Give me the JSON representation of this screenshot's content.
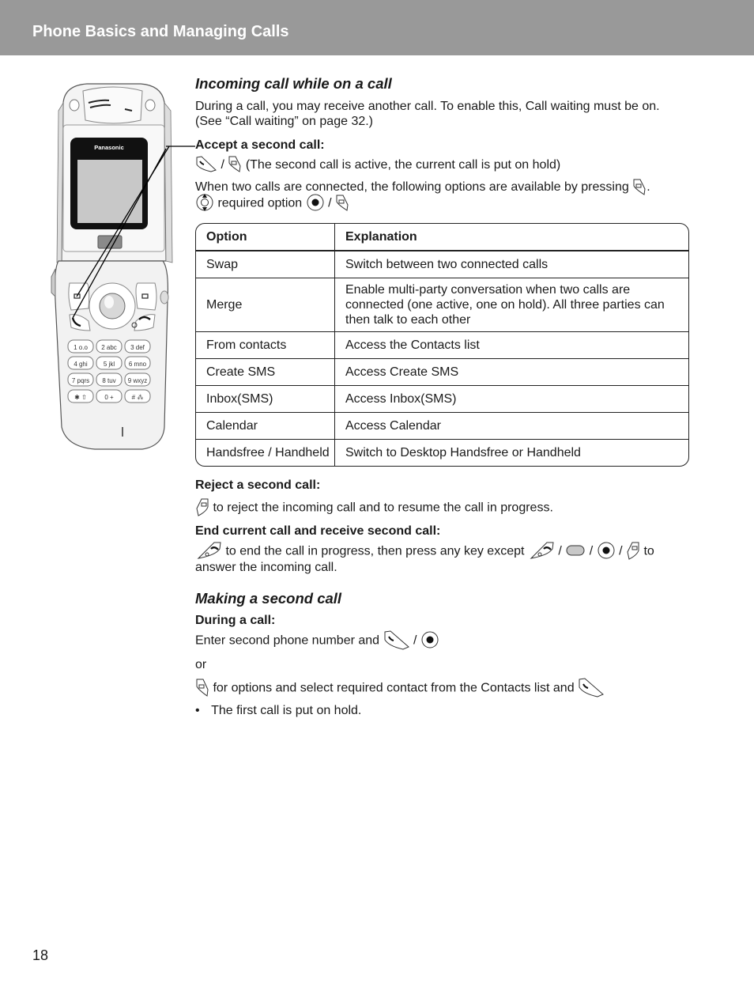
{
  "header": {
    "title": "Phone Basics and Managing Calls"
  },
  "phone_illustration": {
    "brand": "Panasonic",
    "keys": [
      "1 ο.ο",
      "2 abc",
      "3 def",
      "4 ghi",
      "5 jkl",
      "6 mno",
      "7 pqrs",
      "8 tuv",
      "9 wxyz",
      "✱ ⇧",
      "0 +",
      "# ⁂"
    ]
  },
  "section1": {
    "heading": "Incoming call while on a call",
    "intro": "During a call, you may receive another call. To enable this, Call waiting must be on. (See “Call waiting” on page 32.)",
    "accept": {
      "title": "Accept a second call:",
      "separator": "/",
      "text": "(The second call is active, the current call is put on hold)"
    },
    "options_intro": {
      "text": "When two calls are connected, the following options are available by pressing",
      "period": ".",
      "select_text": "required option",
      "separator": "/"
    },
    "table": {
      "headers": [
        "Option",
        "Explanation"
      ],
      "rows": [
        {
          "option": "Swap",
          "explanation": "Switch between two connected calls"
        },
        {
          "option": "Merge",
          "explanation": "Enable multi-party conversation when two calls are connected (one active, one on hold). All three parties can then talk to each other"
        },
        {
          "option": "From contacts",
          "explanation": "Access the Contacts list"
        },
        {
          "option": "Create SMS",
          "explanation": "Access Create SMS"
        },
        {
          "option": "Inbox(SMS)",
          "explanation": "Access Inbox(SMS)"
        },
        {
          "option": "Calendar",
          "explanation": "Access Calendar"
        },
        {
          "option": "Handsfree / Handheld",
          "explanation": "Switch to Desktop Handsfree or Handheld"
        }
      ]
    },
    "reject": {
      "title": "Reject a second call:",
      "text": "to reject the incoming call and to resume the call in progress."
    },
    "end_receive": {
      "title": "End current call and receive second call:",
      "text1": "to end the call in progress, then press any key except",
      "separator": "/",
      "text2": "to answer the incoming call."
    }
  },
  "section2": {
    "heading": "Making a second call",
    "during": "During a call:",
    "enter_text": "Enter second phone number and",
    "separator": "/",
    "or": "or",
    "options_text": "for options and select required contact from the Contacts list and",
    "bullet_char": "•",
    "bullet": "The first call is put on hold."
  },
  "page_number": "18"
}
